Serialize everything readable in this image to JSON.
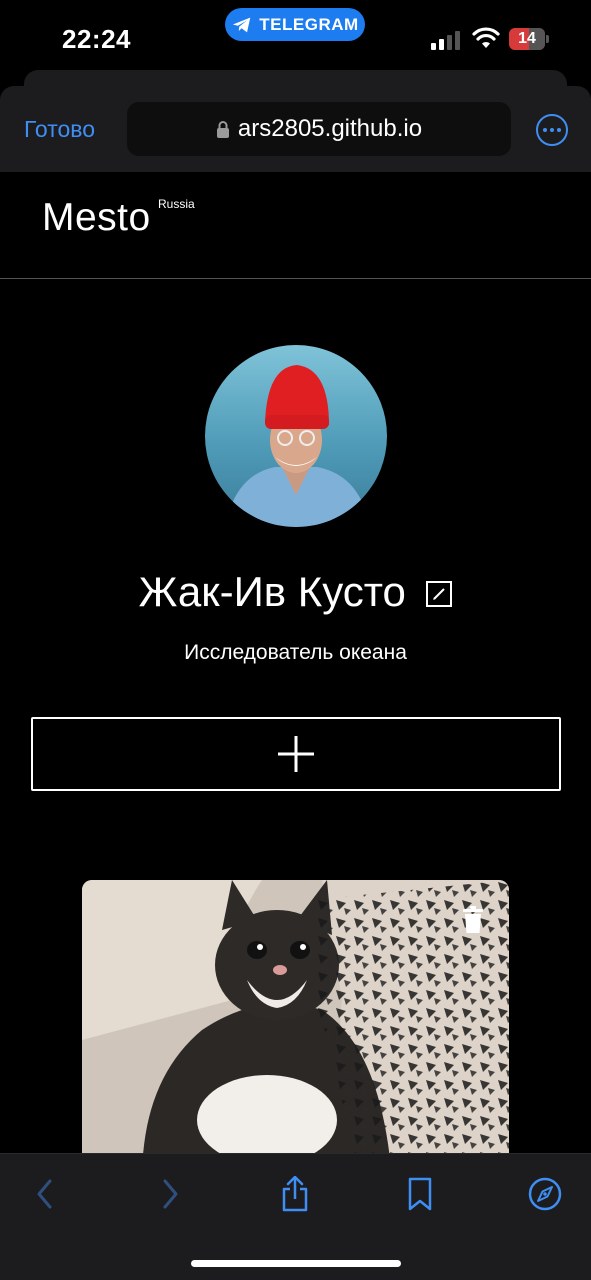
{
  "status": {
    "time": "22:24",
    "pill_label": "TELEGRAM",
    "battery": "14"
  },
  "browser": {
    "done_label": "Готово",
    "url": "ars2805.github.io"
  },
  "header": {
    "logo": "Mesto",
    "logo_sup": "Russia"
  },
  "profile": {
    "name": "Жак-Ив Кусто",
    "about": "Исследователь океана"
  },
  "colors": {
    "accent": "#3f8ef4",
    "telegram": "#1c7cf0",
    "background": "#000000"
  }
}
